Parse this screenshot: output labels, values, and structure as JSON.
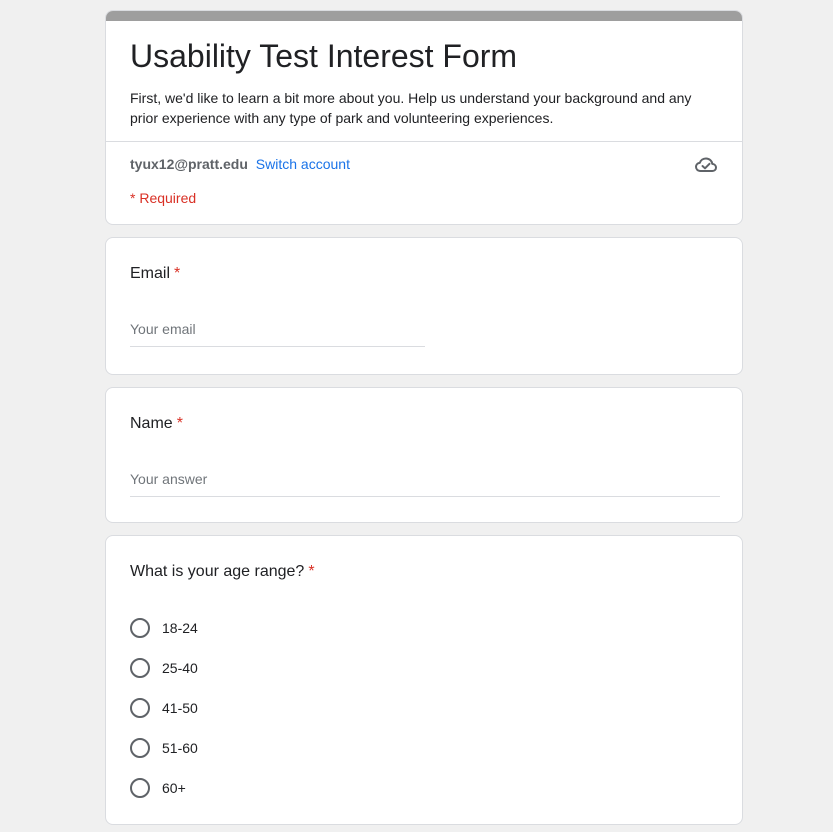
{
  "header": {
    "title": "Usability Test Interest Form",
    "description": "First, we'd like to learn a bit more about you. Help us understand your background and any prior experience with any type of park and volunteering experiences.",
    "account_email": "tyux12@pratt.edu",
    "switch_account": "Switch account",
    "required_note": "* Required",
    "cloud_icon": "cloud-check-icon",
    "bar_color": "#9e9e9e"
  },
  "questions": {
    "email": {
      "label": "Email",
      "required_mark": "*",
      "placeholder": "Your email"
    },
    "name": {
      "label": "Name",
      "required_mark": "*",
      "placeholder": "Your answer"
    },
    "age": {
      "label": "What is your age range?",
      "required_mark": "*",
      "options": [
        "18-24",
        "25-40",
        "41-50",
        "51-60",
        "60+"
      ]
    }
  },
  "colors": {
    "required": "#d93025",
    "link": "#1a73e8",
    "background": "#f0f0f0"
  }
}
